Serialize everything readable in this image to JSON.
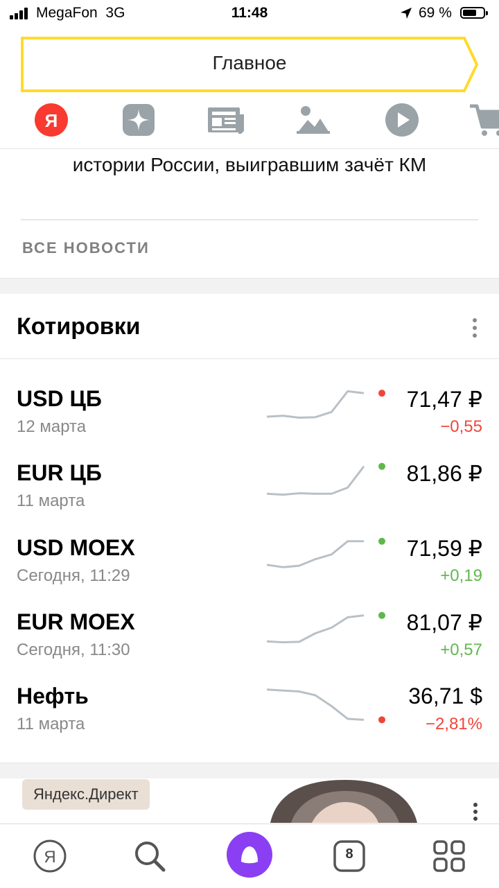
{
  "status_bar": {
    "carrier": "MegaFon",
    "network": "3G",
    "time": "11:48",
    "battery_percent": "69 %",
    "battery_level": 0.69
  },
  "top_nav": {
    "active_tab": "Главное"
  },
  "services": [
    {
      "icon": "yandex-logo-icon",
      "color": "#f93a30"
    },
    {
      "icon": "zen-icon",
      "color": "#9aa3a7"
    },
    {
      "icon": "news-icon",
      "color": "#9aa3a7"
    },
    {
      "icon": "images-icon",
      "color": "#9aa3a7"
    },
    {
      "icon": "video-play-icon",
      "color": "#9aa3a7"
    },
    {
      "icon": "market-cart-icon",
      "color": "#9aa3a7"
    }
  ],
  "news": {
    "headline_tail": "истории России, выигравшим зачёт КМ",
    "all_news_link": "ВСЕ НОВОСТИ"
  },
  "quotes": {
    "title": "Котировки",
    "rows": [
      {
        "name": "USD ЦБ",
        "date": "12 марта",
        "value": "71,47 ₽",
        "change": "−0,55",
        "trend": "down",
        "spark": [
          0.62,
          0.6,
          0.64,
          0.63,
          0.52,
          0.08,
          0.12
        ]
      },
      {
        "name": "EUR ЦБ",
        "date": "11 марта",
        "value": "81,86 ₽",
        "change": "",
        "trend": "up",
        "spark": [
          0.68,
          0.7,
          0.67,
          0.68,
          0.68,
          0.55,
          0.1
        ]
      },
      {
        "name": "USD MOEX",
        "date": "Сегодня, 11:29",
        "value": "71,59 ₽",
        "change": "+0,19",
        "trend": "up",
        "spark": [
          0.6,
          0.65,
          0.62,
          0.48,
          0.38,
          0.1,
          0.1
        ]
      },
      {
        "name": "EUR MOEX",
        "date": "Сегодня, 11:30",
        "value": "81,07 ₽",
        "change": "+0,57",
        "trend": "up",
        "spark": [
          0.65,
          0.67,
          0.66,
          0.48,
          0.36,
          0.14,
          0.1
        ]
      },
      {
        "name": "Нефть",
        "date": "11 марта",
        "value": "36,71 $",
        "change": "−2,81%",
        "trend": "down",
        "spark": [
          0.1,
          0.12,
          0.14,
          0.22,
          0.45,
          0.72,
          0.74
        ]
      }
    ],
    "colors": {
      "down": "#f0453a",
      "up": "#5fb84c",
      "line": "#b9c0c6"
    }
  },
  "ad": {
    "badge": "Яндекс.Директ"
  },
  "bottom_bar": {
    "tabs_count": "8",
    "alice_color": "#8b3ff2"
  }
}
